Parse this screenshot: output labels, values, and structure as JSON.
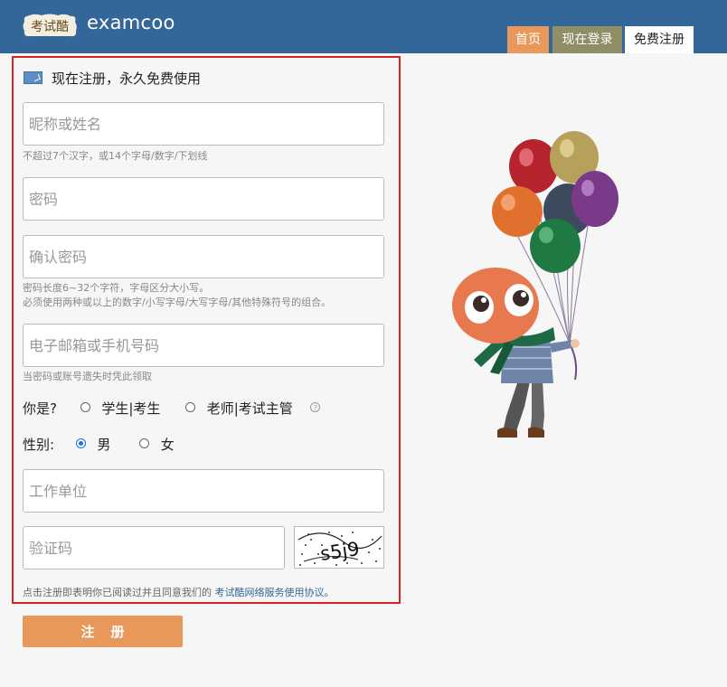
{
  "header": {
    "logo_text": "考试酷",
    "site_name": "examcoo",
    "nav": [
      {
        "label": "首页",
        "color": "#e8985a"
      },
      {
        "label": "现在登录",
        "color": "#8f8e67"
      },
      {
        "label": "免费注册",
        "color": "#ffffff"
      }
    ],
    "bar_color": "#336699"
  },
  "form": {
    "heading": "现在注册，永久免费使用",
    "nickname": {
      "placeholder": "昵称或姓名",
      "value": "",
      "hint": "不超过7个汉字，或14个字母/数字/下划线"
    },
    "password": {
      "placeholder": "密码",
      "value": ""
    },
    "confirm_password": {
      "placeholder": "确认密码",
      "value": "",
      "hint_line1": "密码长度6~32个字符，字母区分大小写。",
      "hint_line2": "必须使用两种或以上的数字/小写字母/大写字母/其他特殊符号的组合。"
    },
    "contact": {
      "placeholder": "电子邮箱或手机号码",
      "value": "",
      "hint": "当密码或账号遗失时凭此领取"
    },
    "role": {
      "label": "你是?",
      "options": [
        "学生|考生",
        "老师|考试主管"
      ],
      "selected": null,
      "help_icon": "help-circle-icon"
    },
    "gender": {
      "label": "性别:",
      "options": [
        "男",
        "女"
      ],
      "selected": "男"
    },
    "workplace": {
      "placeholder": "工作单位",
      "value": ""
    },
    "captcha": {
      "placeholder": "验证码",
      "value": "",
      "image_text": "s5j9"
    },
    "agreement": {
      "prefix": "点击注册即表明你已阅读过并且同意我们的",
      "link": "考试酷网络服务使用协议。"
    },
    "submit_label": "注册"
  },
  "colors": {
    "accent": "#e8985a",
    "frame": "#d9212c",
    "link": "#336699"
  }
}
